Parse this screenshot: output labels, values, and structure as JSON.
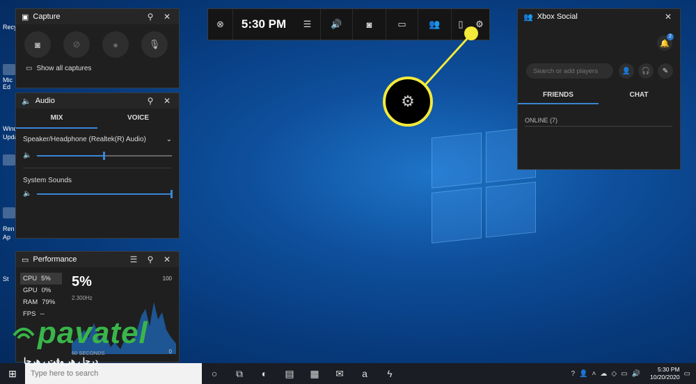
{
  "desktop": {
    "icon_labels": [
      "Recy",
      "Mic",
      "Ed",
      "Wind",
      "Upda",
      "Ren",
      "Ap",
      "St"
    ]
  },
  "capture": {
    "title": "Capture",
    "show_all": "Show all captures",
    "icons": [
      "camera-icon",
      "record-last-icon",
      "record-dot-icon",
      "mic-off-icon"
    ]
  },
  "audio": {
    "title": "Audio",
    "tabs": [
      "MIX",
      "VOICE"
    ],
    "active_tab": "MIX",
    "device": "Speaker/Headphone (Realtek(R) Audio)",
    "device_level": 0.5,
    "system_label": "System Sounds",
    "system_level": 1.0
  },
  "performance": {
    "title": "Performance",
    "metrics": [
      {
        "label": "CPU",
        "value": "5%"
      },
      {
        "label": "GPU",
        "value": "0%"
      },
      {
        "label": "RAM",
        "value": "79%"
      },
      {
        "label": "FPS",
        "value": "--"
      }
    ],
    "big_value": "5%",
    "frequency": "2.300Hz",
    "max": "100",
    "min": "0",
    "window_label": "60 SECONDS"
  },
  "gamebar": {
    "time": "5:30 PM",
    "icons": [
      "xbox-icon",
      "menu-icon",
      "audio-icon",
      "capture-icon",
      "performance-icon",
      "social-icon",
      "mouse-icon",
      "settings-icon"
    ]
  },
  "social": {
    "title": "Xbox Social",
    "search_placeholder": "Search or add players",
    "tabs": [
      "FRIENDS",
      "CHAT"
    ],
    "active_tab": "FRIENDS",
    "online_label": "ONLINE (7)",
    "notification_count": "2"
  },
  "taskbar": {
    "search_placeholder": "Type here to search",
    "time": "5:30 PM",
    "date": "10/20/2020"
  },
  "watermark": {
    "brand": "pavatel",
    "tagline": "درجا ، هر وقت ، هرجا"
  },
  "colors": {
    "accent": "#3a86d8",
    "callout": "#f3ea3a",
    "watermark": "#39b54a"
  }
}
